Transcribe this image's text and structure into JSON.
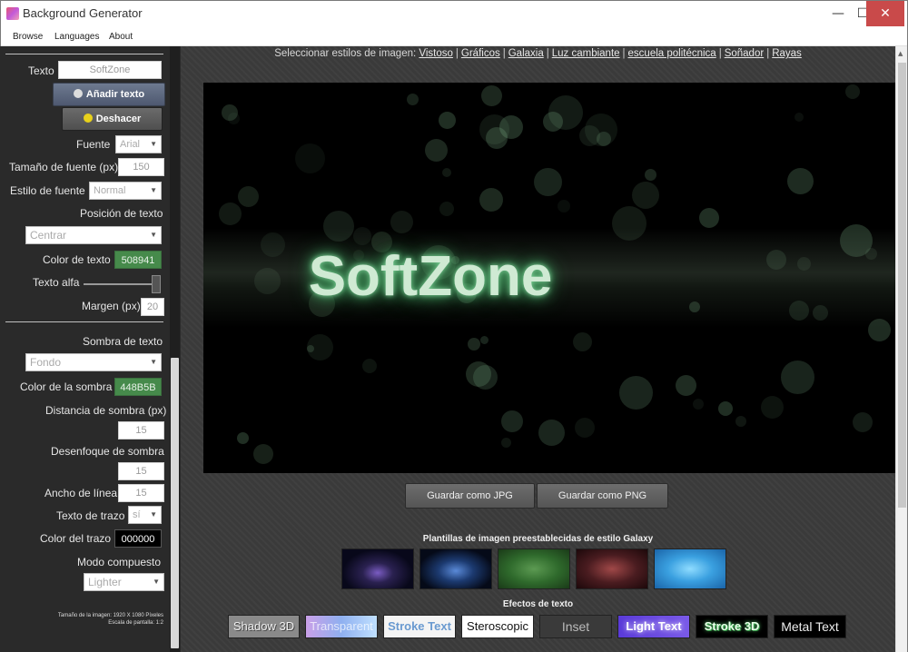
{
  "window": {
    "title": "Background Generator"
  },
  "menu": [
    "Browse",
    "Languages",
    "About"
  ],
  "sidebar": {
    "texto_label": "Texto",
    "texto_value": "SoftZone",
    "add_text_button": "Añadir texto",
    "undo_button": "Deshacer",
    "fuente_label": "Fuente",
    "fuente_value": "Arial",
    "tamano_label": "Tamaño de fuente (px)",
    "tamano_value": "150",
    "estilo_label": "Estilo de fuente",
    "estilo_value": "Normal",
    "posicion_label": "Posición de texto",
    "posicion_value": "Centrar",
    "color_texto_label": "Color de texto",
    "color_texto_value": "508941",
    "alfa_label": "Texto alfa",
    "alfa_level": 1.0,
    "margen_label": "Margen (px)",
    "margen_value": "20",
    "sombra_label": "Sombra de texto",
    "sombra_value": "Fondo",
    "color_sombra_label": "Color de la sombra",
    "color_sombra_value": "448B5B",
    "distancia_label": "Distancia de sombra (px)",
    "distancia_value": "15",
    "desenfoque_label": "Desenfoque de sombra",
    "desenfoque_value": "15",
    "ancho_label": "Ancho de línea",
    "ancho_value": "15",
    "trazo_label": "Texto de trazo",
    "trazo_value": "sí",
    "color_trazo_label": "Color del trazo",
    "color_trazo_value": "000000",
    "modo_label": "Modo compuesto",
    "modo_value": "Lighter",
    "info_line1": "Tamaño de la imagen: 1920 X 1080 Píxeles",
    "info_line2": "Escala de pantalla: 1:2"
  },
  "main": {
    "styles_prefix": "Seleccionar estilos de imagen:",
    "styles": [
      "Vistoso",
      "Gráficos",
      "Galaxia",
      "Luz cambiante",
      "escuela politécnica",
      "Soñador",
      "Rayas"
    ],
    "preview_text": "SoftZone",
    "save_jpg": "Guardar como JPG",
    "save_png": "Guardar como PNG",
    "templates_title": "Plantillas de imagen preestablecidas de estilo Galaxy",
    "effects_title": "Efectos de texto",
    "effects": [
      "Shadow 3D",
      "Transparent",
      "Stroke Text",
      "Steroscopic",
      "Inset",
      "Light Text",
      "Stroke 3D",
      "Metal Text"
    ]
  },
  "colors": {
    "text_color": "#508941",
    "shadow_color": "#448B5B",
    "sidebar_bg": "#2a2a2a",
    "main_bg": "#3a3a3a"
  }
}
